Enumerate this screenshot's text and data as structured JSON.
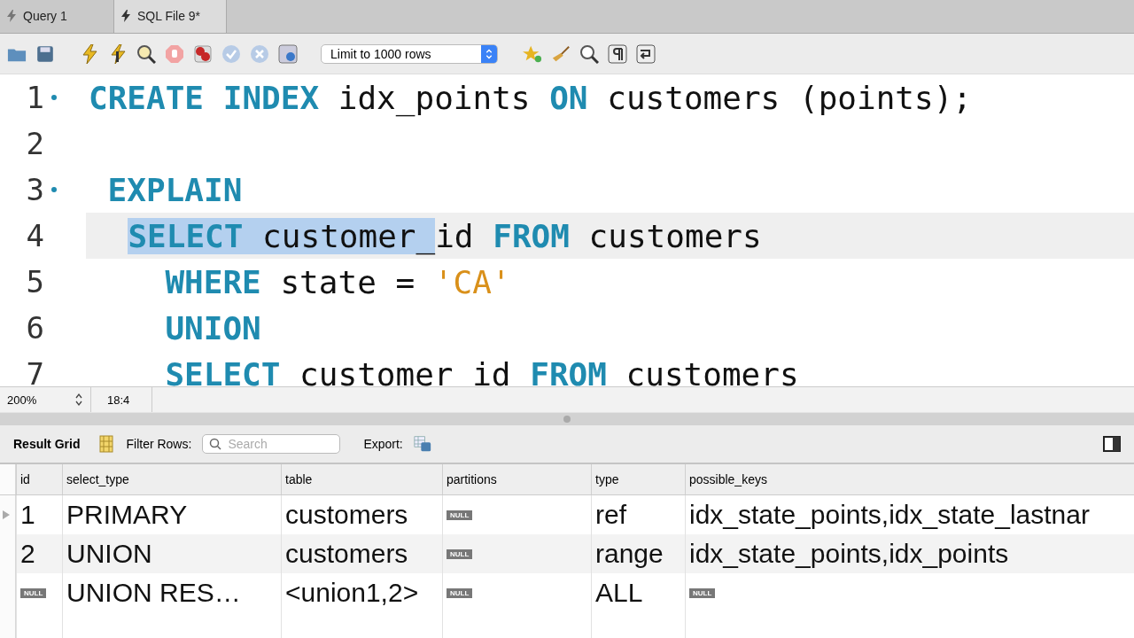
{
  "tabs": [
    {
      "label": "Query 1",
      "selected": false
    },
    {
      "label": "SQL File 9*",
      "selected": true
    }
  ],
  "toolbar": {
    "limit": "Limit to 1000 rows"
  },
  "editor": {
    "lines": [
      {
        "number": "1",
        "marker": true,
        "current": false,
        "kind": "statement",
        "tokens": [
          {
            "text": "CREATE INDEX",
            "kind": "keyword",
            "selected": false
          },
          {
            "text": " idx_points ",
            "kind": "ident",
            "selected": false
          },
          {
            "text": "ON",
            "kind": "keyword",
            "selected": false
          },
          {
            "text": " customers (points);",
            "kind": "ident",
            "selected": false
          }
        ]
      },
      {
        "number": "2",
        "marker": false,
        "current": false,
        "kind": "statement"
      },
      {
        "number": "3",
        "marker": true,
        "current": false,
        "kind": "explain",
        "tokens": [
          {
            "text": "EXPLAIN",
            "kind": "keyword",
            "selected": false
          }
        ]
      },
      {
        "number": "4",
        "marker": false,
        "current": true,
        "kind": "clause",
        "tokens": [
          {
            "text": "SELECT",
            "kind": "keyword",
            "selected": true
          },
          {
            "text": " customer_",
            "kind": "ident",
            "selected": true
          },
          {
            "text": "id ",
            "kind": "ident",
            "selected": false
          },
          {
            "text": "FROM",
            "kind": "keyword",
            "selected": false
          },
          {
            "text": " customers",
            "kind": "ident",
            "selected": false
          }
        ]
      },
      {
        "number": "5",
        "marker": false,
        "current": false,
        "kind": "clause",
        "tokens": [
          {
            "text": "WHERE",
            "kind": "keyword",
            "selected": false
          },
          {
            "text": " state = ",
            "kind": "ident",
            "selected": false
          },
          {
            "text": "'CA'",
            "kind": "string",
            "selected": false
          }
        ]
      },
      {
        "number": "6",
        "marker": false,
        "current": false,
        "kind": "clause",
        "tokens": [
          {
            "text": "UNION",
            "kind": "keyword",
            "selected": false
          }
        ]
      },
      {
        "number": "7",
        "marker": false,
        "current": false,
        "kind": "clause",
        "tokens": [
          {
            "text": "SELECT",
            "kind": "keyword",
            "selected": false
          },
          {
            "text": " customer id ",
            "kind": "ident",
            "selected": false
          },
          {
            "text": "FROM",
            "kind": "keyword",
            "selected": false
          },
          {
            "text": " customers",
            "kind": "ident",
            "selected": false
          }
        ]
      }
    ]
  },
  "status_bar": {
    "zoom": "200%",
    "position": "18:4"
  },
  "result": {
    "title": "Result Grid",
    "filter_label": "Filter Rows:",
    "search_placeholder": "Search",
    "export_label": "Export:",
    "columns": [
      "id",
      "select_type",
      "table",
      "partitions",
      "type",
      "possible_keys"
    ],
    "rows": [
      {
        "selected": true,
        "cells": [
          {
            "text": "1",
            "kind": "text"
          },
          {
            "text": "PRIMARY",
            "kind": "text"
          },
          {
            "text": "customers",
            "kind": "text"
          },
          {
            "text": "NULL",
            "kind": "null"
          },
          {
            "text": "ref",
            "kind": "text"
          },
          {
            "text": "idx_state_points,idx_state_lastnar",
            "kind": "text"
          }
        ]
      },
      {
        "selected": false,
        "cells": [
          {
            "text": "2",
            "kind": "text"
          },
          {
            "text": "UNION",
            "kind": "text"
          },
          {
            "text": "customers",
            "kind": "text"
          },
          {
            "text": "NULL",
            "kind": "null"
          },
          {
            "text": "range",
            "kind": "text"
          },
          {
            "text": "idx_state_points,idx_points",
            "kind": "text"
          }
        ]
      },
      {
        "selected": false,
        "cells": [
          {
            "text": "NULL",
            "kind": "null"
          },
          {
            "text": "UNION RES…",
            "kind": "text"
          },
          {
            "text": "<union1,2>",
            "kind": "text"
          },
          {
            "text": "NULL",
            "kind": "null"
          },
          {
            "text": "ALL",
            "kind": "text"
          },
          {
            "text": "NULL",
            "kind": "null"
          }
        ]
      }
    ]
  }
}
